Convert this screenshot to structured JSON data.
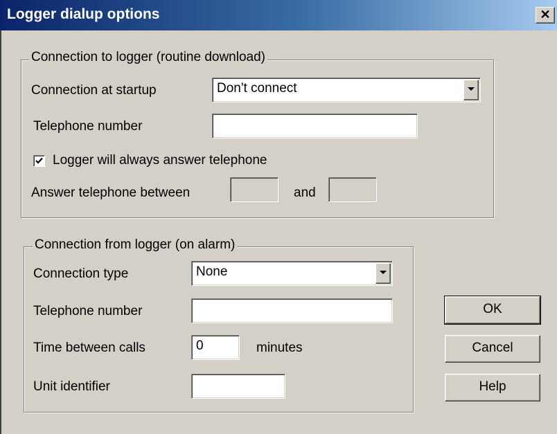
{
  "window": {
    "title": "Logger dialup options",
    "close_glyph": "✕"
  },
  "routine_group": {
    "legend": "Connection to logger (routine download)",
    "connection_at_startup_label": "Connection at startup",
    "connection_at_startup_value": "Don't connect",
    "telephone_label": "Telephone number",
    "telephone_value": "",
    "always_answer_label": "Logger will always answer telephone",
    "always_answer_checked": true,
    "answer_between_label": "Answer telephone between",
    "answer_from_value": "",
    "and_label": "and",
    "answer_to_value": ""
  },
  "alarm_group": {
    "legend": "Connection from logger (on alarm)",
    "connection_type_label": "Connection type",
    "connection_type_value": "None",
    "telephone_label": "Telephone number",
    "telephone_value": "",
    "time_between_label": "Time between calls",
    "time_between_value": "0",
    "minutes_label": "minutes",
    "unit_identifier_label": "Unit identifier",
    "unit_identifier_value": ""
  },
  "buttons": {
    "ok": "OK",
    "cancel": "Cancel",
    "help": "Help"
  },
  "icons": {
    "close": "close-icon",
    "dropdown": "chevron-down-icon",
    "check": "checkmark-icon"
  },
  "colors": {
    "titlebar_start": "#0a246a",
    "titlebar_end": "#a6caf0",
    "face": "#d4d0c8"
  }
}
